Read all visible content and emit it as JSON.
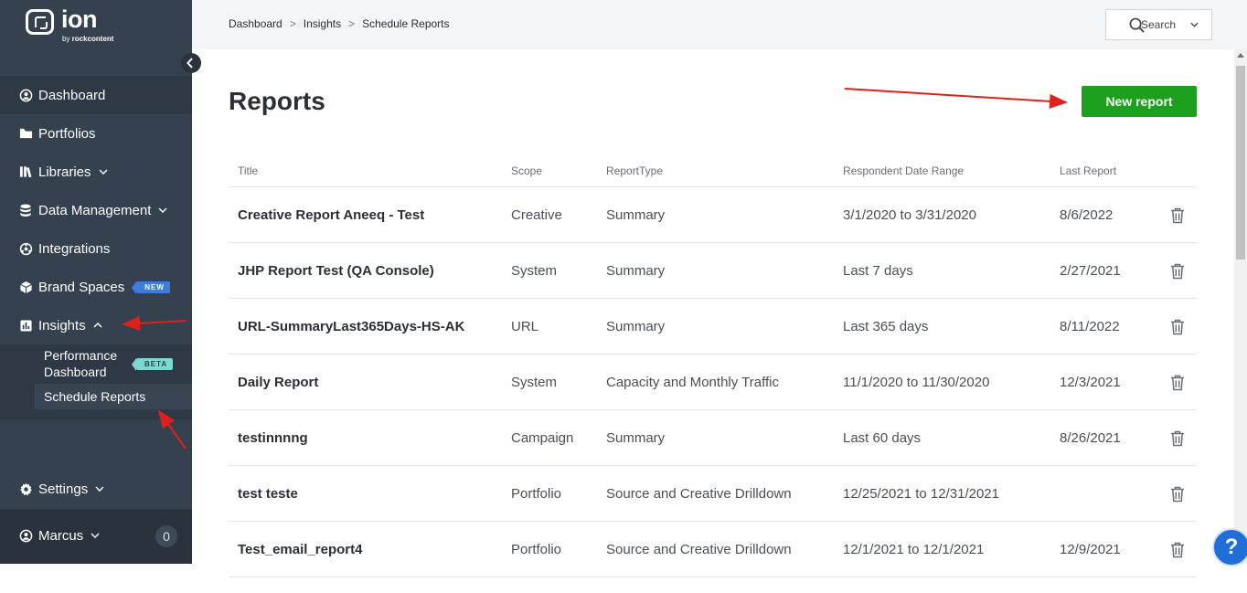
{
  "logo": {
    "text": "ion",
    "sub_prefix": "by ",
    "sub_brand": "rockcontent"
  },
  "sidebar": {
    "items": [
      {
        "label": "Dashboard",
        "icon": "user-circle-icon"
      },
      {
        "label": "Portfolios",
        "icon": "folder-icon"
      },
      {
        "label": "Libraries",
        "icon": "books-icon"
      },
      {
        "label": "Data Management",
        "icon": "database-icon"
      },
      {
        "label": "Integrations",
        "icon": "integrations-icon"
      },
      {
        "label": "Brand Spaces",
        "icon": "cube-icon",
        "badge": "NEW"
      },
      {
        "label": "Insights",
        "icon": "chart-icon"
      }
    ],
    "sub_items": [
      {
        "label_line1": "Performance",
        "label_line2": "Dashboard",
        "badge": "BETA"
      },
      {
        "label": "Schedule Reports"
      }
    ],
    "settings": "Settings",
    "user": {
      "name": "Marcus",
      "count": "0"
    }
  },
  "breadcrumb": [
    "Dashboard",
    "Insights",
    "Schedule Reports"
  ],
  "breadcrumb_sep": ">",
  "search": {
    "label": "Search"
  },
  "page": {
    "title": "Reports",
    "new_report": "New report"
  },
  "table": {
    "headers": [
      "Title",
      "Scope",
      "ReportType",
      "Respondent Date Range",
      "Last Report"
    ],
    "rows": [
      [
        "Creative Report Aneeq - Test",
        "Creative",
        "Summary",
        "3/1/2020 to 3/31/2020",
        "8/6/2022"
      ],
      [
        "JHP Report Test (QA Console)",
        "System",
        "Summary",
        "Last 7 days",
        "2/27/2021"
      ],
      [
        "URL-SummaryLast365Days-HS-AK",
        "URL",
        "Summary",
        "Last 365 days",
        "8/11/2022"
      ],
      [
        "Daily Report",
        "System",
        "Capacity and Monthly Traffic",
        "11/1/2020 to 11/30/2020",
        "12/3/2021"
      ],
      [
        "testinnnng",
        "Campaign",
        "Summary",
        "Last 60 days",
        "8/26/2021"
      ],
      [
        "test teste",
        "Portfolio",
        "Source and Creative Drilldown",
        "12/25/2021 to 12/31/2021",
        ""
      ],
      [
        "Test_email_report4",
        "Portfolio",
        "Source and Creative Drilldown",
        "12/1/2021 to 12/1/2021",
        "12/9/2021"
      ]
    ]
  },
  "help": {
    "label": "?"
  },
  "colors": {
    "sidebar": "#364150",
    "accent_green": "#1da01d",
    "annotation_red": "#e0201b"
  }
}
